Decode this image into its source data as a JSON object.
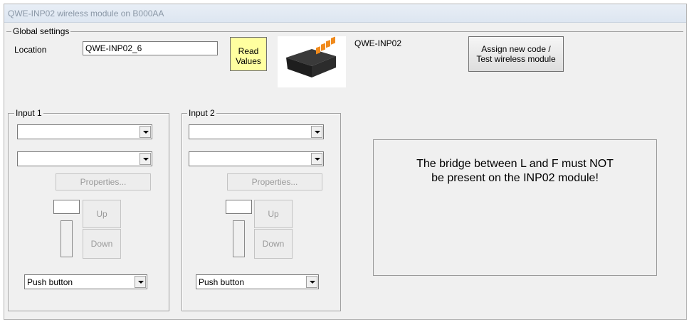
{
  "window": {
    "title": "QWE-INP02 wireless module on B000AA"
  },
  "global": {
    "legend": "Global settings",
    "location_label": "Location",
    "location_value": "QWE-INP02_6",
    "read_values_line1": "Read",
    "read_values_line2": "Values",
    "device_name": "QWE-INP02",
    "assign_line1": "Assign new code /",
    "assign_line2": "Test wireless module"
  },
  "input1": {
    "legend": "Input 1",
    "combo1": "",
    "combo2": "",
    "properties": "Properties...",
    "up": "Up",
    "down": "Down",
    "mode": "Push button"
  },
  "input2": {
    "legend": "Input 2",
    "combo1": "",
    "combo2": "",
    "properties": "Properties...",
    "up": "Up",
    "down": "Down",
    "mode": "Push button"
  },
  "notice": {
    "line1": "The bridge between L and F must NOT",
    "line2": "be present on the INP02 module!"
  }
}
